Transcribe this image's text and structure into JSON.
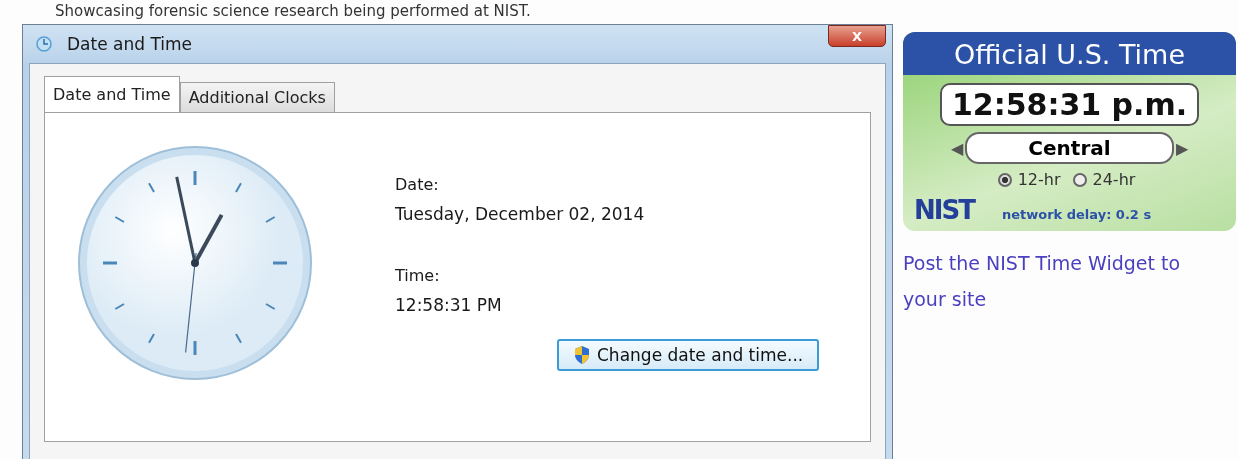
{
  "caption": "Showcasing forensic science research being performed at NIST.",
  "window": {
    "title": "Date and Time",
    "close": "X"
  },
  "tabs": [
    {
      "label": "Date and Time",
      "selected": true
    },
    {
      "label": "Additional Clocks",
      "selected": false
    }
  ],
  "date": {
    "label": "Date:",
    "value": "Tuesday, December 02, 2014"
  },
  "time": {
    "label": "Time:",
    "value": "12:58:31 PM"
  },
  "change_button": "Change date and time...",
  "widget": {
    "title": "Official U.S. Time",
    "time": "12:58:31 p.m.",
    "zone": "Central",
    "prev": "◀",
    "next": "▶",
    "formats": [
      {
        "label": "12-hr",
        "selected": true
      },
      {
        "label": "24-hr",
        "selected": false
      }
    ],
    "logo": "NIST",
    "delay": "network delay: 0.2 s"
  },
  "link": "Post the NIST Time Widget to your site"
}
